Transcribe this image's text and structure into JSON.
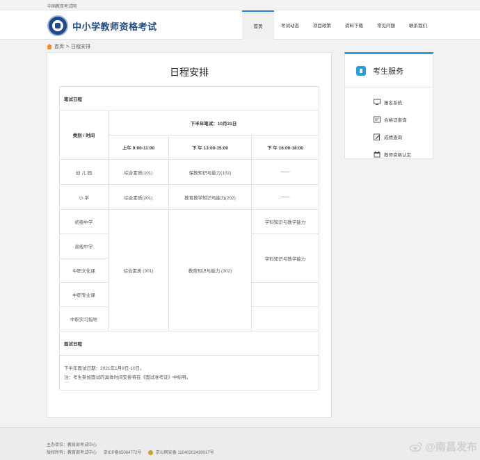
{
  "topbar": {
    "text": "中国教育考试网"
  },
  "header": {
    "site_title": "中小学教师资格考试",
    "nav": [
      {
        "label": "首页",
        "active": true
      },
      {
        "label": "考试动态"
      },
      {
        "label": "项目政策"
      },
      {
        "label": "资料下载"
      },
      {
        "label": "常见问题"
      },
      {
        "label": "联系我们"
      }
    ]
  },
  "breadcrumb": {
    "home": "首页",
    "sep": ">",
    "current": "日程安排"
  },
  "main": {
    "title": "日程安排",
    "table": {
      "section_written": "笔试日程",
      "category_header": "类别 / 时间",
      "exam_date": "下半年笔试：10月31日",
      "slots": [
        "上午  9:00-11:00",
        "下 午  13:00-15:00",
        "下 午  16:00-18:00"
      ],
      "rows": [
        {
          "category": "幼 儿 园",
          "s1": "综合素质(101)",
          "s2": "保教知识与能力(102)",
          "s3": "——"
        },
        {
          "category": "小  学",
          "s1": "综合素质(201)",
          "s2": "教育教学知识与能力(202)",
          "s3": "——"
        },
        {
          "category": "初级中学"
        },
        {
          "category": "高级中学"
        },
        {
          "category": "中职文化课"
        },
        {
          "category": "中职专业课"
        },
        {
          "category": "中职实习指导"
        }
      ],
      "merged_s1": "综合素质 (301)",
      "merged_s2": "教育知识与能力 (302)",
      "middle_s3": "学科知识与教学能力",
      "high_s3": "学科知识与教学能力",
      "section_interview": "面试日程",
      "interview_date": "下半年面试日期：2021年1月9日-10日。",
      "interview_note": "注：考生参加面试的具体时间安排将在《面试准考证》中标明。"
    }
  },
  "sidebar": {
    "title": "考生服务",
    "items": [
      {
        "label": "报名系统",
        "icon": "monitor-icon"
      },
      {
        "label": "合格证查询",
        "icon": "certificate-icon"
      },
      {
        "label": "成绩查询",
        "icon": "edit-icon"
      },
      {
        "label": "教师资格认定",
        "icon": "calendar-icon"
      }
    ]
  },
  "footer": {
    "sponsor": "主办单位：教育部考试中心",
    "copyright": "版权所有：教育部考试中心",
    "icp": "京ICP备05064772号",
    "police": "京公网安备 11040202430017号",
    "watermark": "@南昌发布"
  },
  "colors": {
    "brand": "#1d4a8a",
    "accent": "#2a9ee0"
  }
}
